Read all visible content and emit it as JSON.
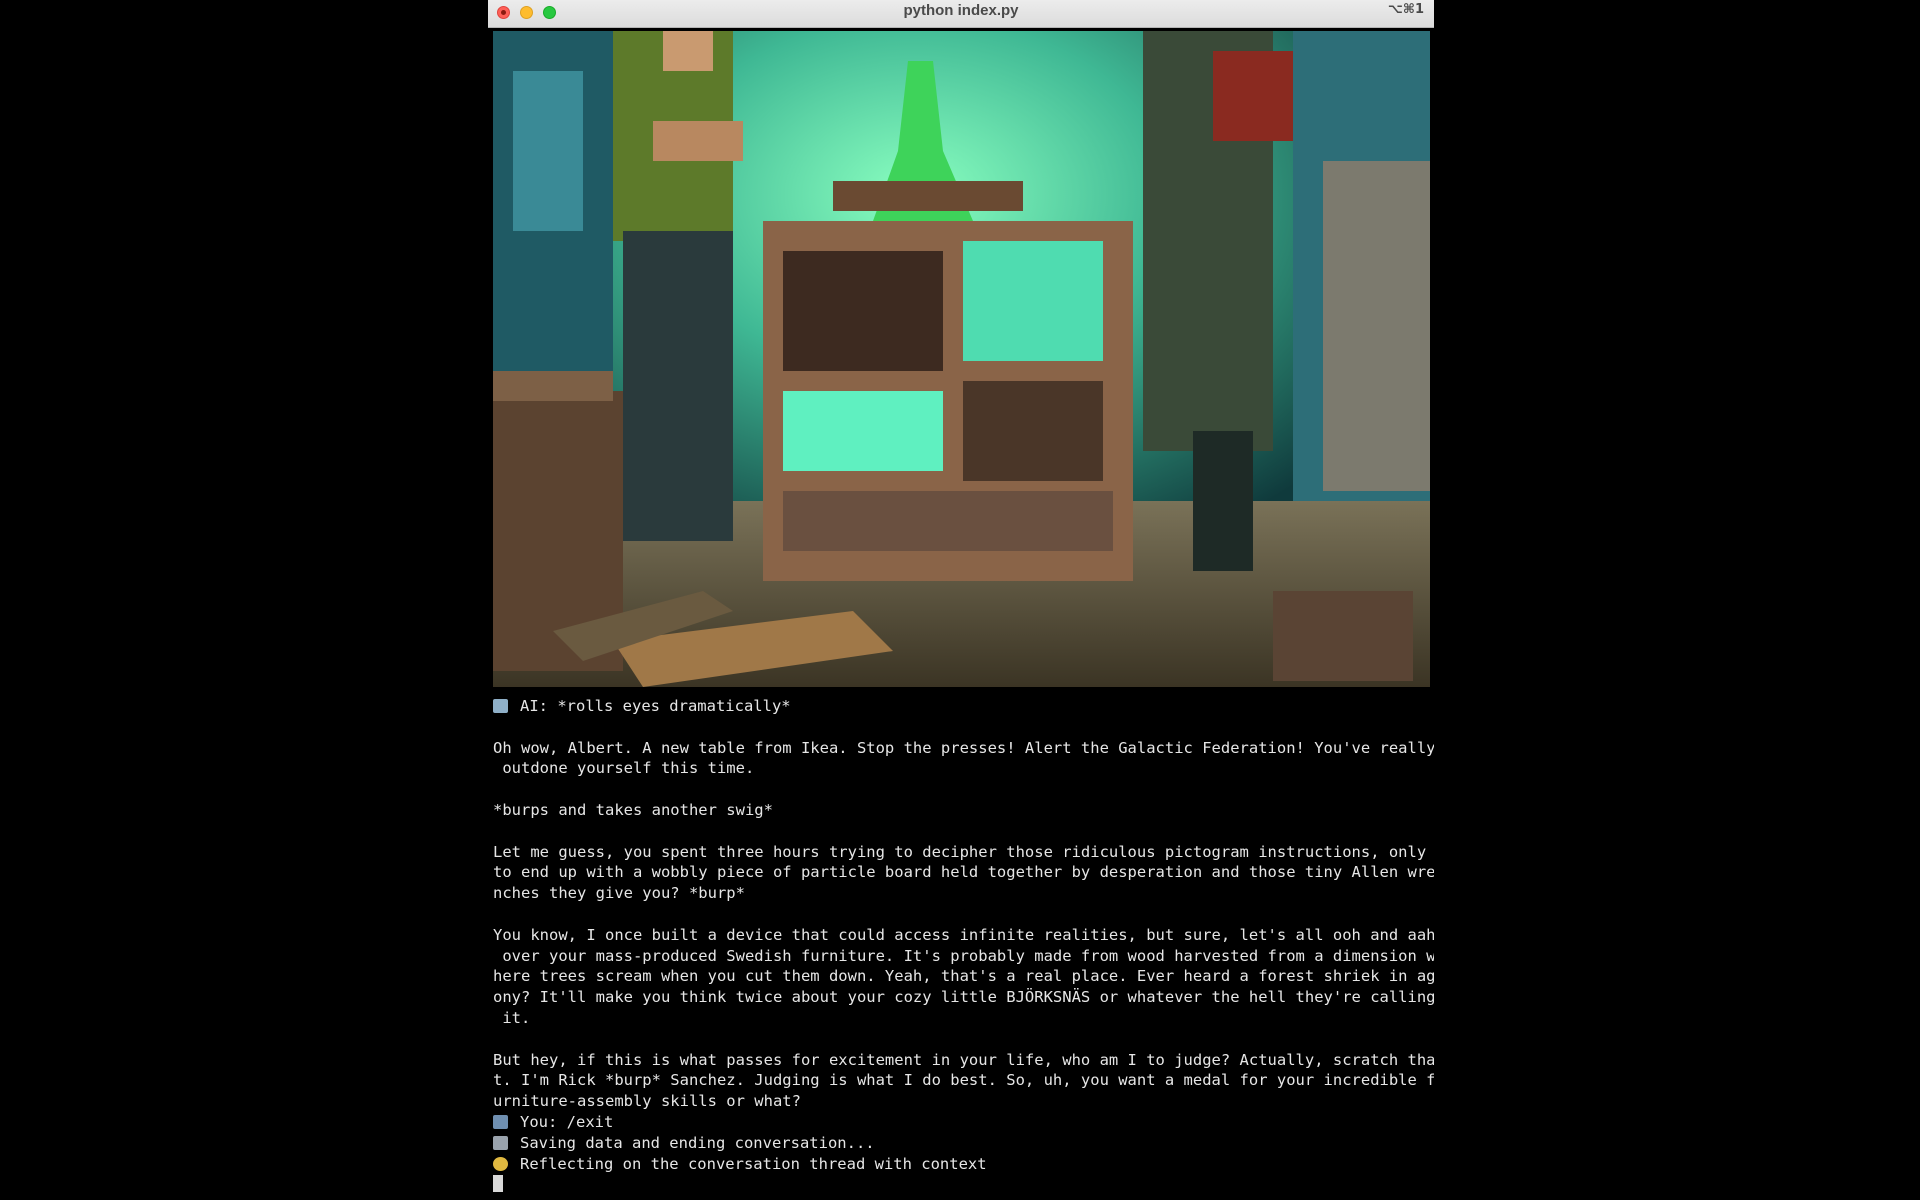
{
  "window": {
    "title": "python index.py",
    "shortcut": "⌥⌘1"
  },
  "image": {
    "description_icon": "generated-pixel-art-lab-scene"
  },
  "terminal": {
    "lines": [
      {
        "icon": "robot-icon",
        "text": "AI: *rolls eyes dramatically*"
      },
      {
        "icon": null,
        "text": ""
      },
      {
        "icon": null,
        "text": "Oh wow, Albert. A new table from Ikea. Stop the presses! Alert the Galactic Federation! You've really"
      },
      {
        "icon": null,
        "text": " outdone yourself this time."
      },
      {
        "icon": null,
        "text": ""
      },
      {
        "icon": null,
        "text": "*burps and takes another swig*"
      },
      {
        "icon": null,
        "text": ""
      },
      {
        "icon": null,
        "text": "Let me guess, you spent three hours trying to decipher those ridiculous pictogram instructions, only"
      },
      {
        "icon": null,
        "text": "to end up with a wobbly piece of particle board held together by desperation and those tiny Allen wre"
      },
      {
        "icon": null,
        "text": "nches they give you? *burp*"
      },
      {
        "icon": null,
        "text": ""
      },
      {
        "icon": null,
        "text": "You know, I once built a device that could access infinite realities, but sure, let's all ooh and aah"
      },
      {
        "icon": null,
        "text": " over your mass-produced Swedish furniture. It's probably made from wood harvested from a dimension w"
      },
      {
        "icon": null,
        "text": "here trees scream when you cut them down. Yeah, that's a real place. Ever heard a forest shriek in ag"
      },
      {
        "icon": null,
        "text": "ony? It'll make you think twice about your cozy little BJÖRKSNÄS or whatever the hell they're calling"
      },
      {
        "icon": null,
        "text": " it."
      },
      {
        "icon": null,
        "text": ""
      },
      {
        "icon": null,
        "text": "But hey, if this is what passes for excitement in your life, who am I to judge? Actually, scratch tha"
      },
      {
        "icon": null,
        "text": "t. I'm Rick *burp* Sanchez. Judging is what I do best. So, uh, you want a medal for your incredible f"
      },
      {
        "icon": null,
        "text": "urniture-assembly skills or what?"
      },
      {
        "icon": "user-icon",
        "text": "You: /exit"
      },
      {
        "icon": "floppy-disk-icon",
        "text": "Saving data and ending conversation..."
      },
      {
        "icon": "thinking-face-icon",
        "text": "Reflecting on the conversation thread with context"
      }
    ]
  },
  "colors": {
    "terminal_bg": "#000000",
    "terminal_fg": "#e6e6e6",
    "close": "#fe5f57",
    "minimize": "#febc2e",
    "maximize": "#28c840"
  }
}
